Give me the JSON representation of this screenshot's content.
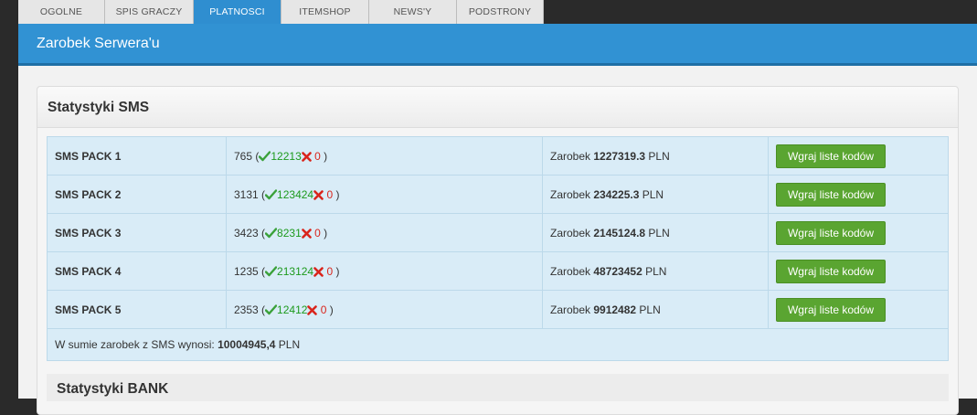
{
  "nav": {
    "tabs": [
      {
        "label": "OGOLNE"
      },
      {
        "label": "SPIS GRACZY"
      },
      {
        "label": "PLATNOSCI"
      },
      {
        "label": "ITEMSHOP"
      },
      {
        "label": "NEWS'Y"
      },
      {
        "label": "PODSTRONY"
      }
    ],
    "active_index": 2
  },
  "header": {
    "title": "Zarobek Serwera'u"
  },
  "sms_panel": {
    "title": "Statystyki SMS",
    "rows": [
      {
        "name": "SMS PACK 1",
        "count": "765",
        "ok": "12213",
        "bad": "0",
        "earn_prefix": "Zarobek ",
        "earn_value": "1227319.3",
        "earn_suffix": " PLN",
        "button": "Wgraj liste kodów"
      },
      {
        "name": "SMS PACK 2",
        "count": "3131",
        "ok": "123424",
        "bad": "0",
        "earn_prefix": "Zarobek ",
        "earn_value": "234225.3",
        "earn_suffix": " PLN",
        "button": "Wgraj liste kodów"
      },
      {
        "name": "SMS PACK 3",
        "count": "3423",
        "ok": "8231",
        "bad": "0",
        "earn_prefix": "Zarobek ",
        "earn_value": "2145124.8",
        "earn_suffix": " PLN",
        "button": "Wgraj liste kodów"
      },
      {
        "name": "SMS PACK 4",
        "count": "1235",
        "ok": "213124",
        "bad": "0",
        "earn_prefix": "Zarobek ",
        "earn_value": "48723452",
        "earn_suffix": " PLN",
        "button": "Wgraj liste kodów"
      },
      {
        "name": "SMS PACK 5",
        "count": "2353",
        "ok": "12412",
        "bad": "0",
        "earn_prefix": "Zarobek ",
        "earn_value": "9912482",
        "earn_suffix": " PLN",
        "button": "Wgraj liste kodów"
      }
    ],
    "total_label": "W sumie zarobek z SMS wynosi: ",
    "total_value": "10004945,4",
    "total_suffix": " PLN"
  },
  "bank_panel": {
    "title": "Statystyki BANK"
  },
  "colors": {
    "accent": "#3192d3",
    "ok": "#1d9a1d",
    "bad": "#d9251c",
    "button": "#5aa531"
  },
  "icons": {
    "ok": "check-icon",
    "bad": "cross-icon"
  }
}
